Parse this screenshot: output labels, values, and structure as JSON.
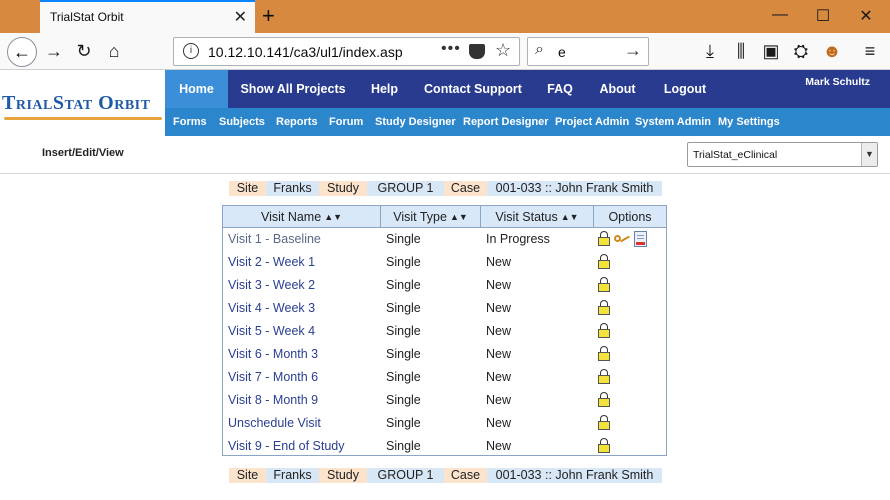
{
  "browser": {
    "tab_title": "TrialStat Orbit",
    "url": "10.12.10.141/ca3/ul1/index.asp",
    "search_value": "e"
  },
  "app": {
    "logo_text": "TrialStat Orbit",
    "user_name": "Mark Schultz",
    "main_nav": [
      "Home",
      "Show All Projects",
      "Help",
      "Contact Support",
      "FAQ",
      "About",
      "Logout"
    ],
    "active_nav": "Home",
    "sub_nav": [
      "Forms",
      "Subjects",
      "Reports",
      "Forum",
      "Study Designer",
      "Report Designer",
      "Project Admin",
      "System Admin",
      "My Settings"
    ],
    "page_mode": "Insert/Edit/View",
    "study_select": "TrialStat_eClinical"
  },
  "breadcrumb": {
    "site_label": "Site",
    "site_value": "Franks",
    "study_label": "Study",
    "study_value": "GROUP 1",
    "case_label": "Case",
    "case_value": "001-033 :: John Frank Smith"
  },
  "table": {
    "headers": [
      "Visit Name",
      "Visit Type",
      "Visit Status",
      "Options"
    ],
    "rows": [
      {
        "name": "Visit 1 - Baseline",
        "type": "Single",
        "status": "In Progress"
      },
      {
        "name": "Visit 2 - Week 1",
        "type": "Single",
        "status": "New"
      },
      {
        "name": "Visit 3 - Week 2",
        "type": "Single",
        "status": "New"
      },
      {
        "name": "Visit 4 - Week 3",
        "type": "Single",
        "status": "New"
      },
      {
        "name": "Visit 5 - Week 4",
        "type": "Single",
        "status": "New"
      },
      {
        "name": "Visit 6 - Month 3",
        "type": "Single",
        "status": "New"
      },
      {
        "name": "Visit 7 - Month 6",
        "type": "Single",
        "status": "New"
      },
      {
        "name": "Visit 8 - Month 9",
        "type": "Single",
        "status": "New"
      },
      {
        "name": "Unschedule Visit",
        "type": "Single",
        "status": "New"
      },
      {
        "name": "Visit 9 - End of Study",
        "type": "Single",
        "status": "New"
      }
    ]
  },
  "colors": {
    "tab_strip": "#d6893f",
    "nav_dark": "#283b8f",
    "nav_active": "#3a8fd8",
    "subnav": "#2b86cc",
    "crumb_label_bg": "#fbe3cc",
    "crumb_value_bg": "#d7e7f6",
    "table_header_bg": "#d8e8f8"
  }
}
